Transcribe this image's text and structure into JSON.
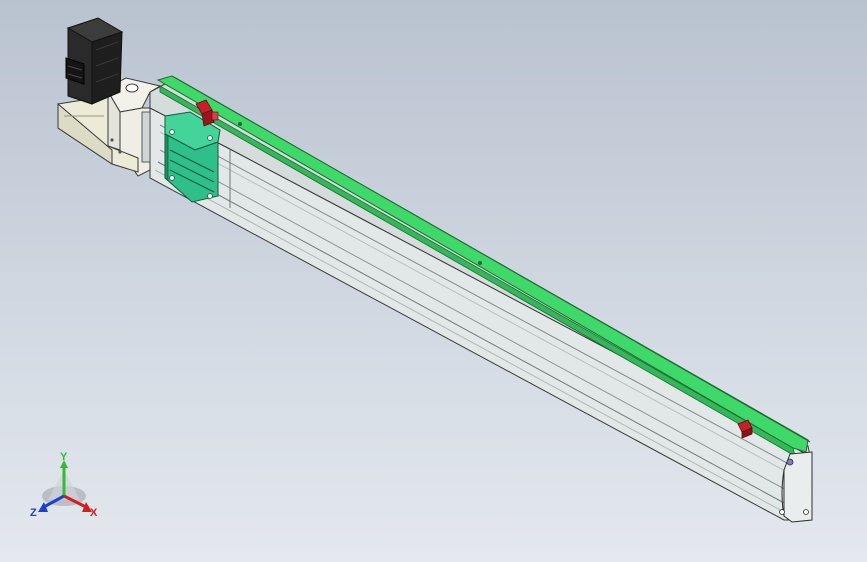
{
  "viewport": {
    "background_top": "#b9c3cf",
    "background_bottom": "#e4e8ee"
  },
  "model": {
    "parts": [
      "servo-motor",
      "motor-adapter-bracket",
      "coupling-housing",
      "linear-actuator-body",
      "guide-rail",
      "carriage-slider",
      "limit-sensor",
      "end-cap"
    ],
    "colors": {
      "motor": "#2a2a2a",
      "bracket": "#e8e8dc",
      "rail_green": "#3fd96a",
      "carriage_teal": "#2fbf8a",
      "sensor_red": "#c8202a",
      "body_light": "#dde3e3",
      "body_shadow": "#9aa4a6"
    }
  },
  "triad": {
    "x_label": "X",
    "y_label": "Y",
    "z_label": "Z",
    "x_color": "#d41e1e",
    "y_color": "#2fbf2f",
    "z_color": "#1e3fd4"
  }
}
